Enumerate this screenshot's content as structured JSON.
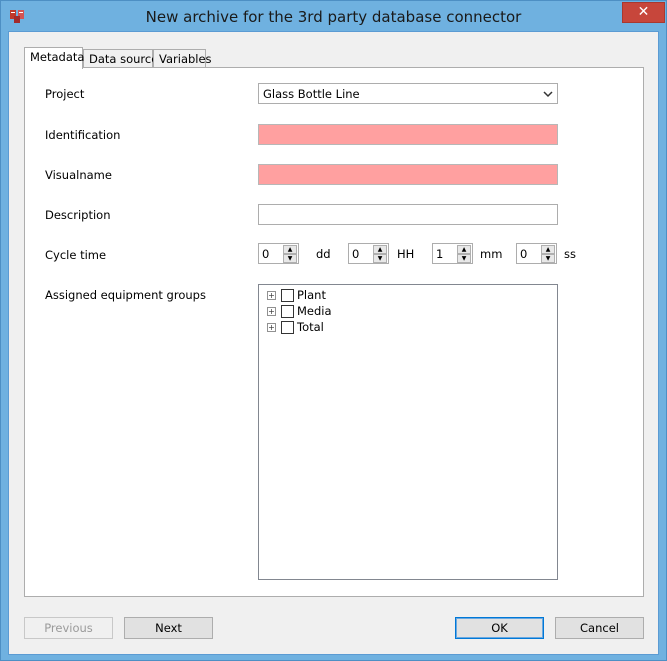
{
  "window": {
    "title": "New archive for the 3rd party database connector",
    "close_glyph": "✕"
  },
  "tabs": [
    {
      "label": "Metadata",
      "active": true
    },
    {
      "label": "Data source",
      "active": false
    },
    {
      "label": "Variables",
      "active": false
    }
  ],
  "form": {
    "project": {
      "label": "Project",
      "value": "Glass Bottle Line"
    },
    "identification": {
      "label": "Identification",
      "value": ""
    },
    "visualname": {
      "label": "Visualname",
      "value": ""
    },
    "description": {
      "label": "Description",
      "value": ""
    },
    "cycle_time": {
      "label": "Cycle time",
      "fields": [
        {
          "value": "0",
          "unit": "dd"
        },
        {
          "value": "0",
          "unit": "HH"
        },
        {
          "value": "1",
          "unit": "mm"
        },
        {
          "value": "0",
          "unit": "ss"
        }
      ]
    },
    "equipment_groups": {
      "label": "Assigned equipment groups",
      "items": [
        {
          "name": "Plant",
          "checked": false
        },
        {
          "name": "Media",
          "checked": false
        },
        {
          "name": "Total",
          "checked": false
        }
      ]
    }
  },
  "buttons": {
    "previous": "Previous",
    "next": "Next",
    "ok": "OK",
    "cancel": "Cancel"
  },
  "colors": {
    "titlebar": "#6fb1e0",
    "invalid_field": "#ffa0a0",
    "close_button": "#c7463b"
  }
}
